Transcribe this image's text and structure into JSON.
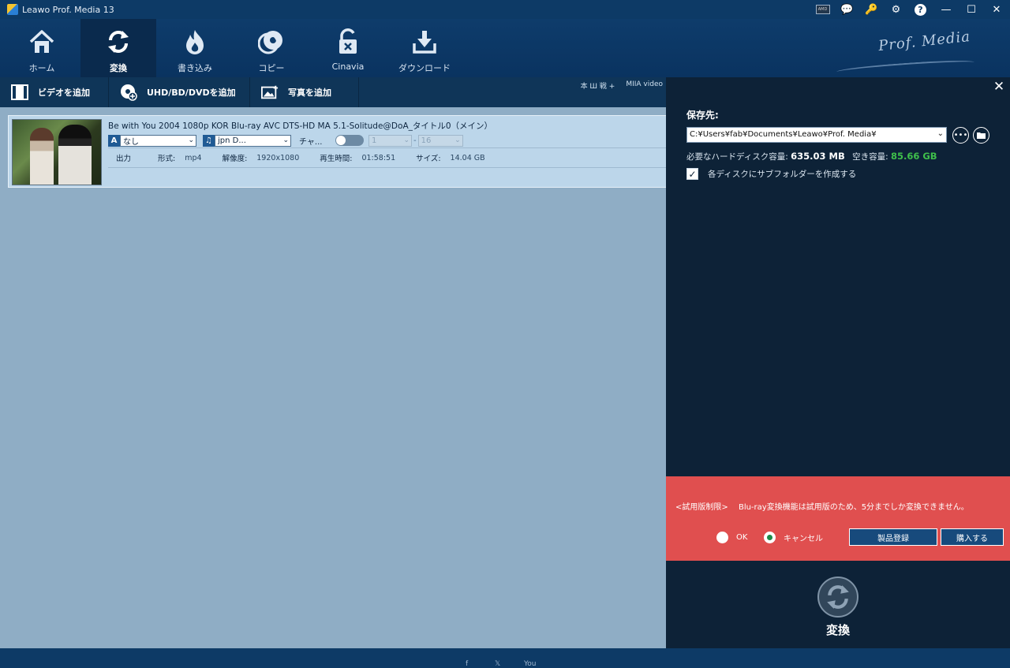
{
  "window": {
    "title": "Leawo Prof. Media 13",
    "title_icons": [
      "amd-icon",
      "chat-icon",
      "key-icon",
      "gear-icon",
      "help-icon",
      "minimize-icon",
      "maximize-icon",
      "close-icon"
    ],
    "title_glyphs": {
      "amd": "AMD",
      "chat": "💬",
      "key": "🔑",
      "gear": "⚙",
      "help": "?",
      "minimize": "—",
      "maximize": "☐",
      "close": "✕"
    }
  },
  "nav": {
    "items": [
      {
        "label": "ホーム",
        "icon": "home-icon"
      },
      {
        "label": "変換",
        "icon": "convert-icon",
        "active": true
      },
      {
        "label": "書き込み",
        "icon": "burn-icon"
      },
      {
        "label": "コピー",
        "icon": "copy-icon"
      },
      {
        "label": "Cinavia",
        "icon": "cinavia-icon"
      },
      {
        "label": "ダウンロード",
        "icon": "download-icon"
      }
    ],
    "brand": "Prof. Media"
  },
  "toolbar": {
    "add_video": "ビデオを追加",
    "add_disc": "UHD/BD/DVDを追加",
    "add_photo": "写真を追加",
    "right_clipped_1": "本 Ш 戦 +",
    "right_clipped_2": "MIIA video"
  },
  "file": {
    "title": "Be with You 2004 1080p KOR Blu-ray AVC DTS-HD MA 5.1-Solitude@DoA_タイトル0（メイン）",
    "subtitle_badge": "A",
    "subtitle_value": "なし",
    "audio_badge": "♫",
    "audio_value": "jpn D...",
    "chapter_label": "チャ...",
    "range_start": "1",
    "range_sep": "-",
    "range_end": "16",
    "info": {
      "output_label": "出力",
      "format_label": "形式:",
      "format_value": "mp4",
      "resolution_label": "解像度:",
      "resolution_value": "1920x1080",
      "duration_label": "再生時間:",
      "duration_value": "01:58:51",
      "size_label": "サイズ:",
      "size_value": "14.04 GB"
    }
  },
  "panel": {
    "close": "✕",
    "save_to_label": "保存先:",
    "path": "C:¥Users¥fab¥Documents¥Leawo¥Prof. Media¥",
    "more_glyph": "•••",
    "folder_glyph": "📂",
    "required_label": "必要なハードディスク容量:",
    "required_value": "635.03 MB",
    "free_label": "空き容量:",
    "free_value": "85.66 GB",
    "subfolder_checked": true,
    "subfolder_label": "各ディスクにサブフォルダーを作成する",
    "trial": {
      "tag": "<試用版制限>",
      "message": "Blu-ray変換機能は試用版のため、5分までしか変換できません。",
      "ok_label": "OK",
      "cancel_label": "キャンセル",
      "selected": "cancel",
      "register_button": "製品登録",
      "buy_button": "購入する"
    },
    "convert_label": "変換"
  },
  "statusbar": {
    "social": [
      "f",
      "𝕏",
      "You"
    ]
  },
  "colors": {
    "accent_blue": "#0d3a66",
    "trial_red": "#e04f4f",
    "free_space_green": "#3fbf4b"
  }
}
